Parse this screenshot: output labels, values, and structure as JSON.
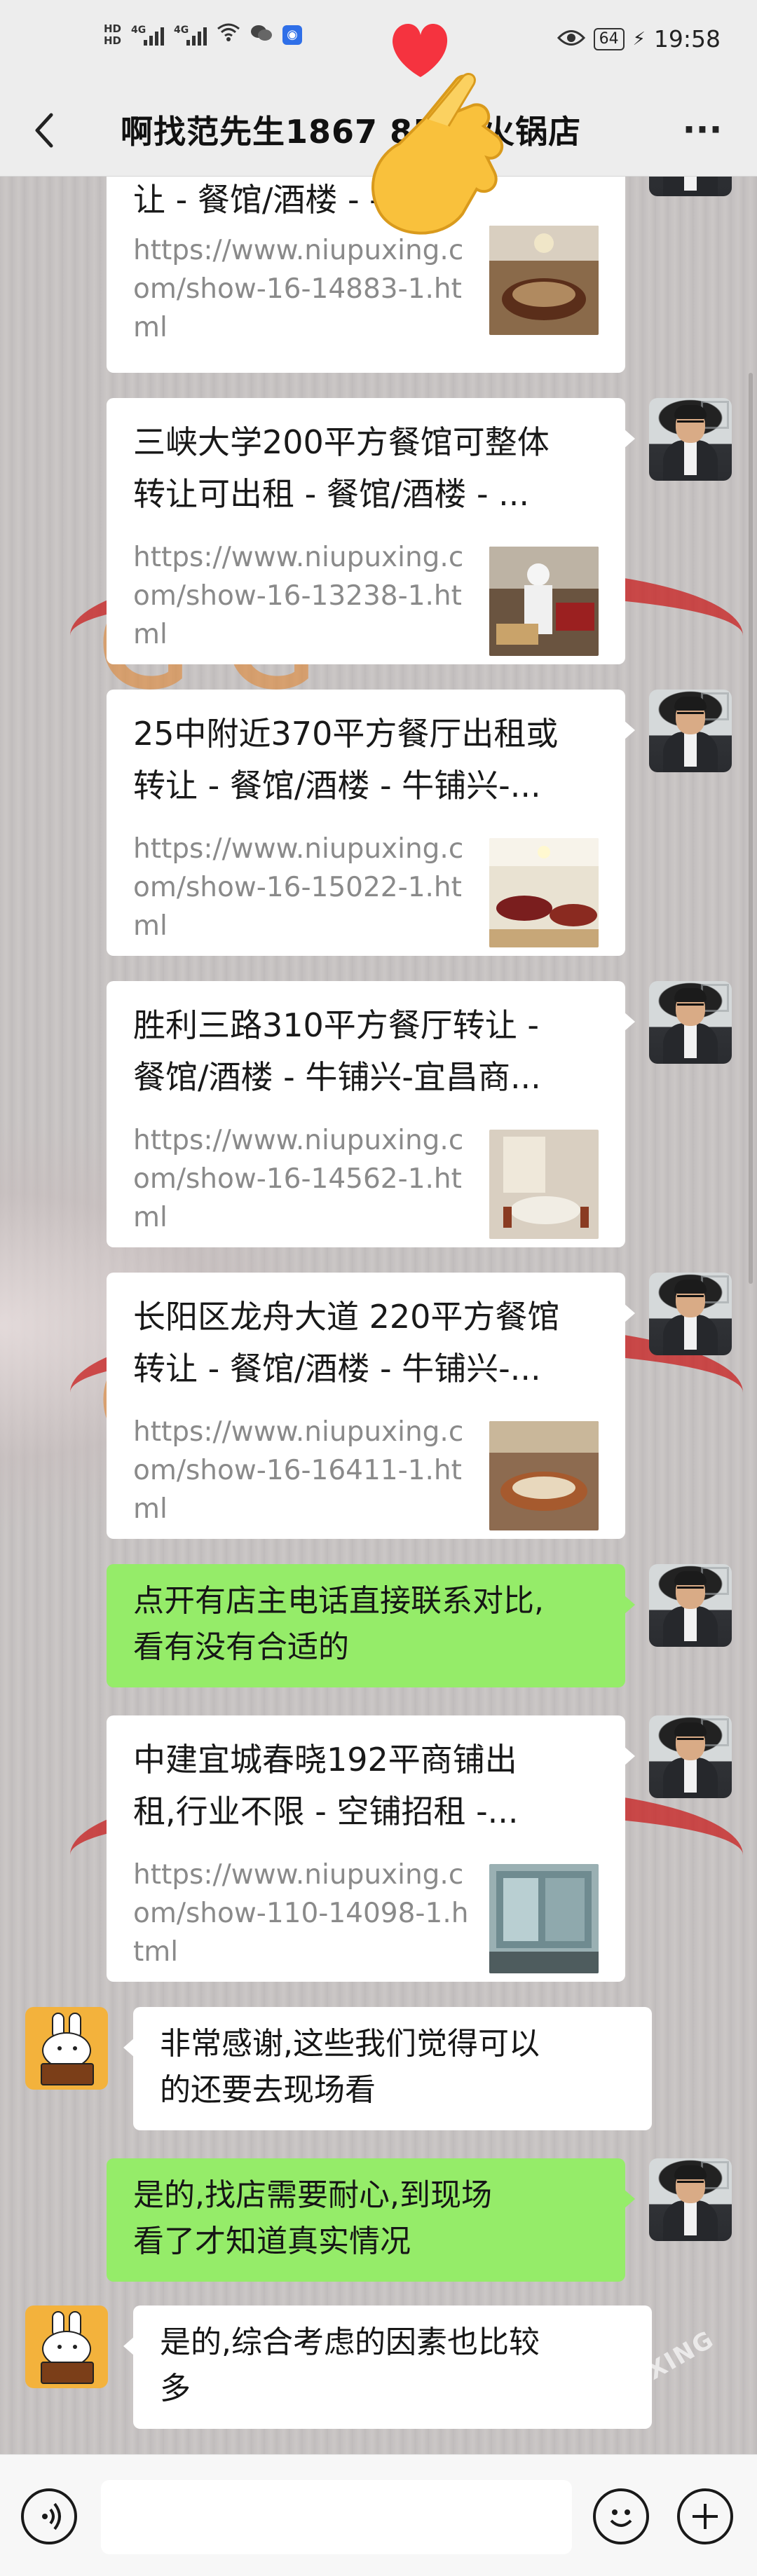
{
  "status_bar": {
    "time": "19:58",
    "battery": "64",
    "hd1": "HD",
    "hd2": "HD",
    "net1": "4G",
    "net2": "4G"
  },
  "header": {
    "title": "啊找范先生1867   8588火锅店",
    "back_icon": "back-arrow-icon",
    "more_icon": "more-dots-icon",
    "more_label": "···"
  },
  "messages": [
    {
      "type": "link_card",
      "sender": "self",
      "title_lines": [
        "让 - 餐馆/酒楼 -     -宜..."
      ],
      "url": "https://www.niupuxing.com/show-16-14883-1.html",
      "thumb": "restaurant-dining-room"
    },
    {
      "type": "link_card",
      "sender": "self",
      "title_lines": [
        "三峡大学200平方餐馆可整体",
        "转让可出租 - 餐馆/酒楼 - ..."
      ],
      "url": "https://www.niupuxing.com/show-16-13238-1.html",
      "thumb": "chef-kitchen"
    },
    {
      "type": "link_card",
      "sender": "self",
      "title_lines": [
        "25中附近370平方餐厅出租或",
        "转让 - 餐馆/酒楼 - 牛铺兴-..."
      ],
      "url": "https://www.niupuxing.com/show-16-15022-1.html",
      "thumb": "banquet-hall"
    },
    {
      "type": "link_card",
      "sender": "self",
      "title_lines": [
        "胜利三路310平方餐厅转让 -",
        "餐馆/酒楼 - 牛铺兴-宜昌商..."
      ],
      "url": "https://www.niupuxing.com/show-16-14562-1.html",
      "thumb": "private-room"
    },
    {
      "type": "link_card",
      "sender": "self",
      "title_lines": [
        "长阳区龙舟大道 220平方餐馆",
        "转让 - 餐馆/酒楼 - 牛铺兴-..."
      ],
      "url": "https://www.niupuxing.com/show-16-16411-1.html",
      "thumb": "round-table-room"
    },
    {
      "type": "text",
      "sender": "self",
      "lines": [
        "点开有店主电话直接联系对比,",
        "看有没有合适的"
      ]
    },
    {
      "type": "link_card",
      "sender": "self",
      "title_lines": [
        "中建宜城春晓192平商铺出",
        "租,行业不限 - 空铺招租 -..."
      ],
      "url": "https://www.niupuxing.com/show-110-14098-1.html",
      "thumb": "shop-window"
    },
    {
      "type": "text",
      "sender": "other",
      "lines": [
        "非常感谢,这些我们觉得可以",
        "的还要去现场看"
      ]
    },
    {
      "type": "text",
      "sender": "self",
      "lines": [
        "是的,找店需要耐心,到现场",
        "看了才知道真实情况"
      ]
    },
    {
      "type": "text",
      "sender": "other",
      "lines": [
        "是的,综合考虑的因素也比较",
        "多"
      ]
    }
  ],
  "input_bar": {
    "voice_icon": "voice-icon",
    "emoji_icon": "emoji-icon",
    "plus_icon": "plus-icon",
    "placeholder": ""
  },
  "watermark": "NIUXING",
  "colors": {
    "green_bubble": "#95ec69",
    "white_bubble": "#ffffff",
    "header_bg": "#ededed"
  }
}
